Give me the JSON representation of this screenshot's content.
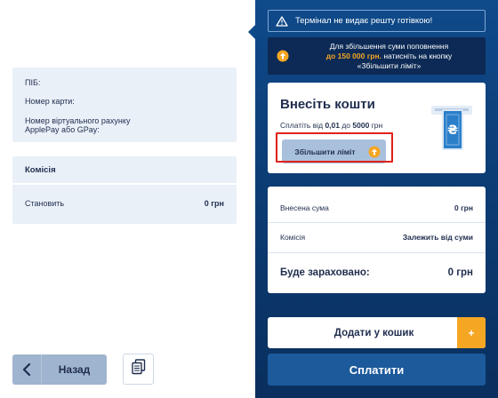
{
  "left": {
    "info": {
      "full_name_label": "ПІБ:",
      "card_number_label": "Номер карти:",
      "virtual_account_label_line1": "Номер віртуального рахунку",
      "virtual_account_label_line2": "ApplePay або GPay:"
    },
    "commission_card": {
      "title": "Комісія",
      "amount_label": "Становить",
      "amount_value": "0 грн"
    },
    "back_button": {
      "label": "Назад"
    },
    "copy_button": {
      "icon": "copy-icon"
    }
  },
  "right": {
    "warning": {
      "text": "Термінал не видає решту готівкою!",
      "icon": "warning-icon"
    },
    "limit_note": {
      "line1": "Для збільшення суми поповнення",
      "highlight": "до 150 000 грн.",
      "line2_rest": " натисніть на кнопку",
      "line3": "«Збільшити ліміт»"
    },
    "deposit": {
      "title": "Внесіть кошти",
      "range_prefix": "Сплатіть від ",
      "min": "0,01",
      "range_mid": " до ",
      "max": "5000",
      "range_suffix": " грн",
      "increase_button": "Збільшити ліміт"
    },
    "summary": {
      "deposited_label": "Внесена сума",
      "deposited_value": "0 грн",
      "commission_label": "Комісія",
      "commission_value": "Залежить від суми",
      "credited_label": "Буде зараховано:",
      "credited_value": "0 грн"
    },
    "cart_button": {
      "label": "Додати у кошик",
      "plus": "+"
    },
    "pay_button": {
      "label": "Сплатити"
    }
  },
  "colors": {
    "accent": "#f5a623",
    "panel_dark": "#0c3d75",
    "highlight_border": "#e0201a"
  }
}
